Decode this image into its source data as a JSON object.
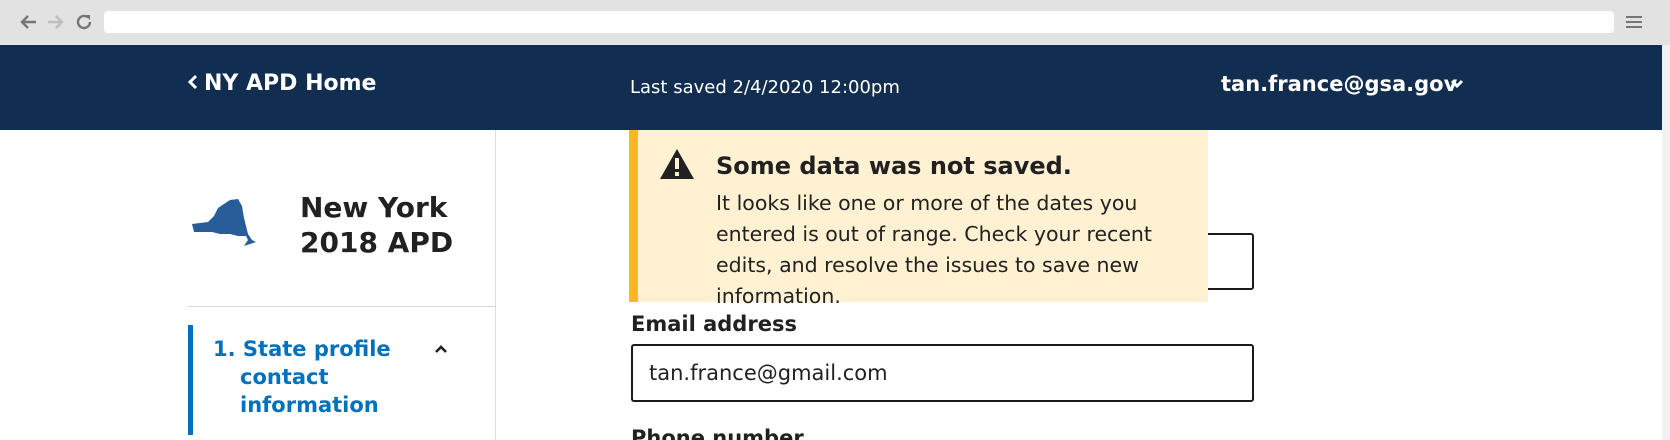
{
  "header": {
    "home_link": "NY APD Home",
    "last_saved": "Last saved 2/4/2020 12:00pm",
    "user_email": "tan.france@gsa.gov"
  },
  "sidebar": {
    "apd_title_line1": "New York",
    "apd_title_line2": "2018 APD",
    "nav_items": [
      {
        "number": "1.",
        "label_line1": "State profile",
        "label_line2": "contact",
        "label_line3": "information"
      }
    ]
  },
  "alert": {
    "heading": "Some data was not saved.",
    "body": "It looks like one or more of the dates you entered is out of range. Check your recent edits, and resolve the issues to save new information."
  },
  "form": {
    "email_label": "Email address",
    "email_value": "tan.france@gmail.com",
    "phone_label": "Phone number"
  },
  "colors": {
    "header_bg": "#112e51",
    "link_blue": "#0071bc",
    "alert_bg": "#fff1d2",
    "alert_border": "#fdb81e"
  },
  "icons": [
    "back-arrow-icon",
    "forward-arrow-icon",
    "reload-icon",
    "menu-icon",
    "chevron-left-icon",
    "chevron-down-icon",
    "new-york-state-icon",
    "chevron-up-icon",
    "warning-icon"
  ]
}
